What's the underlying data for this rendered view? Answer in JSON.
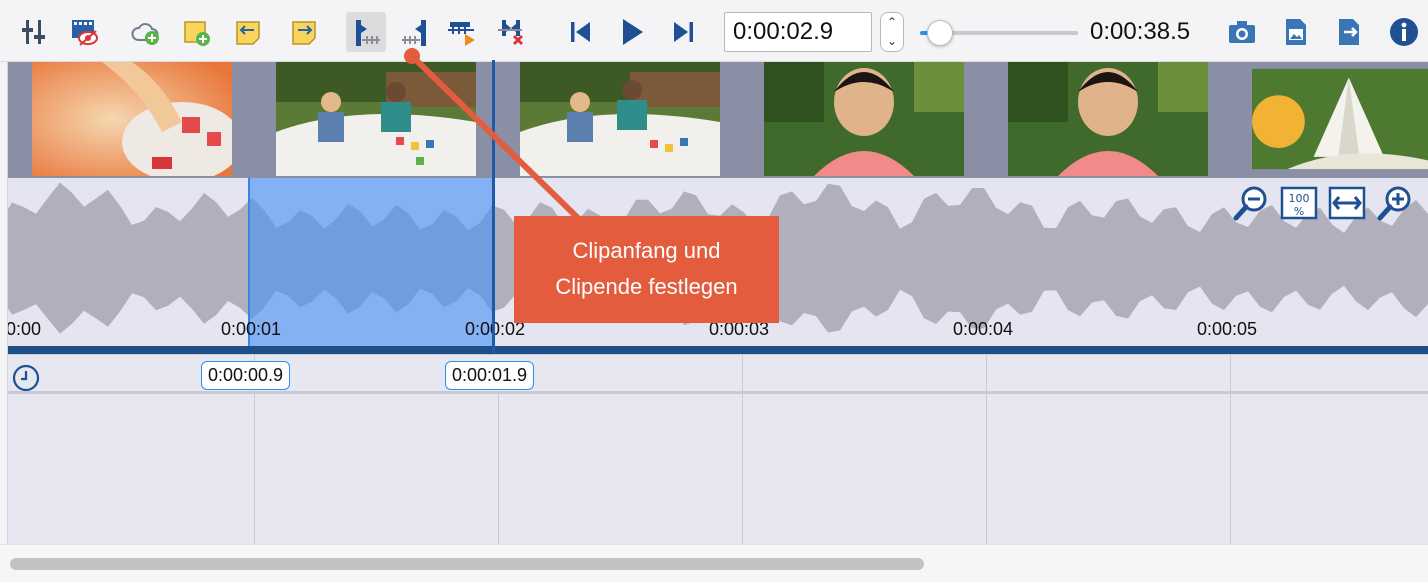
{
  "toolbar": {
    "buttons": [
      {
        "name": "equalizer-button",
        "icon": "sliders-icon"
      },
      {
        "name": "video-effects-button",
        "icon": "film-eye-icon"
      },
      {
        "name": "add-media-button",
        "icon": "cloud-add-icon"
      },
      {
        "name": "new-note-button",
        "icon": "note-add-icon"
      },
      {
        "name": "note-back-button",
        "icon": "note-left-arrow-icon"
      },
      {
        "name": "note-forward-button",
        "icon": "note-right-arrow-icon"
      },
      {
        "name": "set-clip-start-button",
        "icon": "clip-start-icon"
      },
      {
        "name": "set-clip-end-button",
        "icon": "clip-end-icon"
      },
      {
        "name": "play-clip-button",
        "icon": "clip-play-icon"
      },
      {
        "name": "remove-clip-button",
        "icon": "clip-remove-icon"
      }
    ],
    "current_time": "0:00:02.9",
    "duration": "0:00:38.5",
    "playback_progress": 0.075
  },
  "timeline": {
    "ruler_labels": [
      "0:00",
      "0:00:01",
      "0:00:02",
      "0:00:03",
      "0:00:04",
      "0:00:05"
    ],
    "zoom_buttons": [
      "zoom-out",
      "zoom-100",
      "fit-width",
      "zoom-in"
    ]
  },
  "markers": {
    "clip_start": "0:00:00.9",
    "clip_end": "0:00:01.9"
  },
  "callout": {
    "line1": "Clipanfang und",
    "line2": "Clipende festlegen",
    "color": "#e25c3d"
  },
  "colors": {
    "accent": "#2d8df1",
    "selection": "#4991f6",
    "playhead": "#1e5aa8"
  }
}
